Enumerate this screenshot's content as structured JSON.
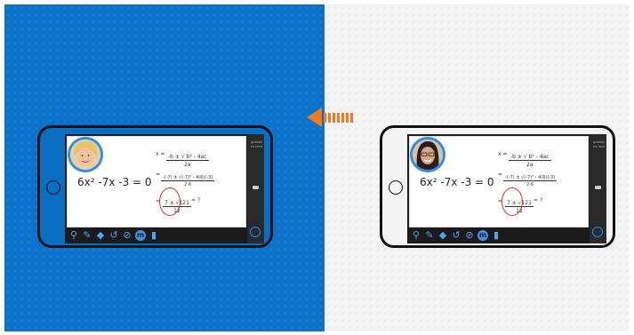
{
  "left_pane": {
    "background": "#0a72c9"
  },
  "right_pane": {
    "background": "#f3f3f3"
  },
  "accent_orange": "#f07a22",
  "transfer_arrow": {
    "direction": "right-to-left",
    "icon": "arrow-left-dashed-icon"
  },
  "whiteboard": {
    "equation": "6x² -7x -3 = 0",
    "formula_x": "x =",
    "formula_top": "-b ± √ b² - 4ac",
    "formula_bottom": "2a",
    "step_equals": "=",
    "step1_top": "-(-7) ± √(-7)² - 4(6)(-3)",
    "step1_bottom": "2·6",
    "step2_top": "7 ± √121",
    "step2_bottom": "12",
    "step2_tail": "= ?",
    "side_text": "questions here"
  },
  "toolbar_icons": [
    "zoom-icon",
    "pen-icon",
    "eraser-icon",
    "undo-icon",
    "attach-icon",
    "record-icon",
    "trash-icon"
  ],
  "tool_glyphs": {
    "zoom": "⚲",
    "pen": "✎",
    "eraser": "◆",
    "undo": "↺",
    "attach": "⊘",
    "record": "m",
    "trash": "▮"
  }
}
